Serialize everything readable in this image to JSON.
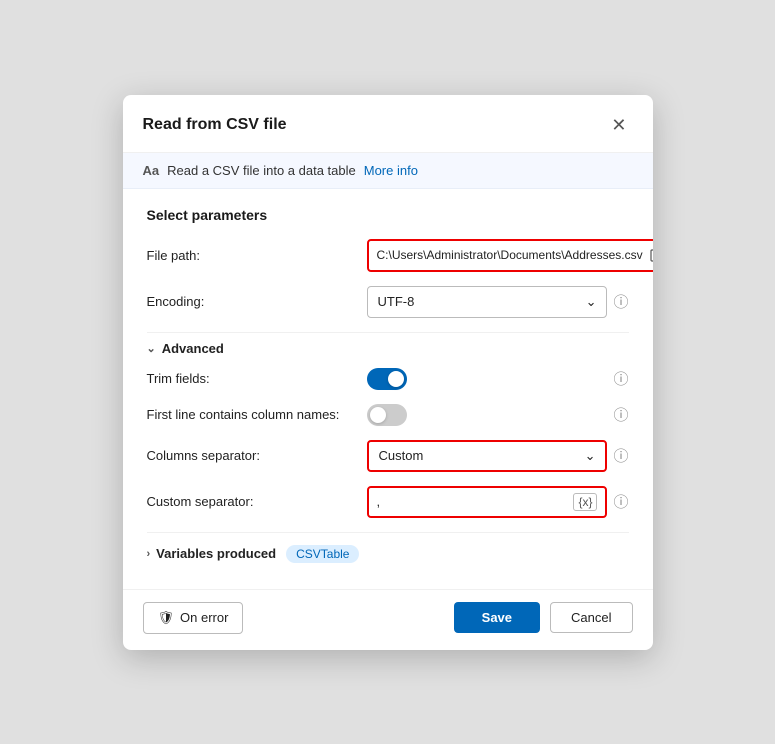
{
  "dialog": {
    "title": "Read from CSV file",
    "close_label": "✕",
    "info_text": "Read a CSV file into a data table",
    "info_link": "More info",
    "section_title": "Select parameters"
  },
  "form": {
    "file_path_label": "File path:",
    "file_path_value": "C:\\Users\\Administrator\\Documents\\Addresses.csv",
    "file_icon": "📄",
    "curly_braces": "{x}",
    "encoding_label": "Encoding:",
    "encoding_value": "UTF-8",
    "advanced_label": "Advanced",
    "trim_fields_label": "Trim fields:",
    "trim_fields_on": true,
    "first_line_label": "First line contains column names:",
    "first_line_on": false,
    "columns_separator_label": "Columns separator:",
    "columns_separator_value": "Custom",
    "custom_separator_label": "Custom separator:",
    "custom_separator_value": ","
  },
  "variables": {
    "label": "Variables produced",
    "badge": "CSVTable"
  },
  "footer": {
    "on_error_label": "On error",
    "save_label": "Save",
    "cancel_label": "Cancel",
    "shield_icon": "🛡"
  }
}
